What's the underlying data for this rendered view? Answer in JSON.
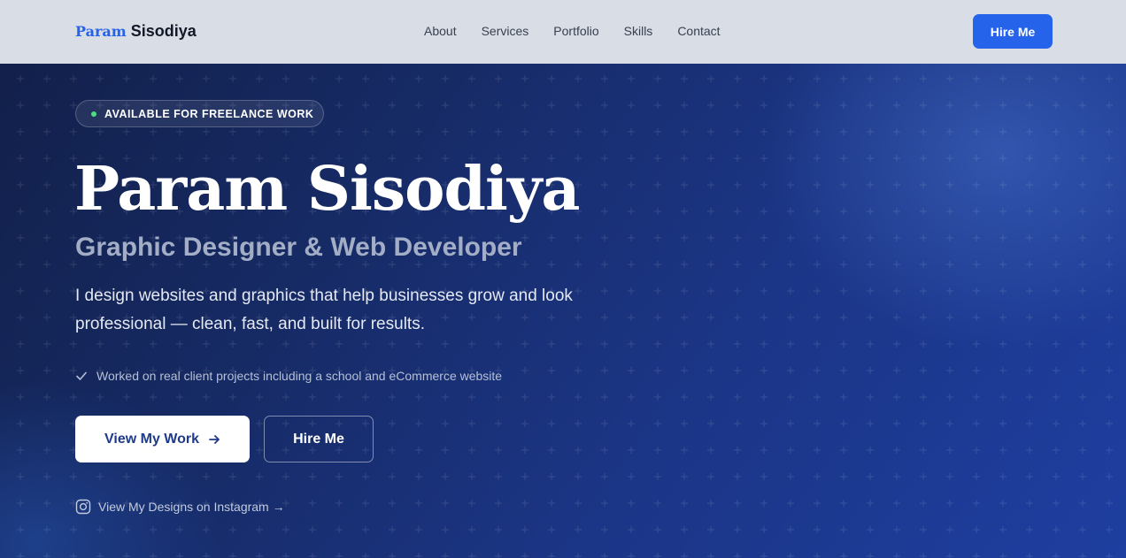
{
  "brand": {
    "first": "Param",
    "last": "Sisodiya"
  },
  "nav": {
    "links": [
      "About",
      "Services",
      "Portfolio",
      "Skills",
      "Contact"
    ],
    "hire_label": "Hire Me"
  },
  "hero": {
    "badge": "AVAILABLE FOR FREELANCE WORK",
    "name": "Param Sisodiya",
    "role": "Graphic Designer & Web Developer",
    "description": "I design websites and graphics that help businesses grow and look professional — clean, fast, and built for results.",
    "proof": "Worked on real client projects including a school and eCommerce website",
    "primary_cta": "View My Work",
    "secondary_cta": "Hire Me",
    "instagram_link": "View My Designs on Instagram →"
  },
  "colors": {
    "accent": "#2563eb",
    "badge_dot": "#4ade80",
    "navbar_bg": "#d9dde5"
  },
  "icons": {
    "badge": "status-dot-icon",
    "proof": "check-icon",
    "primary_cta": "arrow-right-icon",
    "instagram": "instagram-icon"
  }
}
